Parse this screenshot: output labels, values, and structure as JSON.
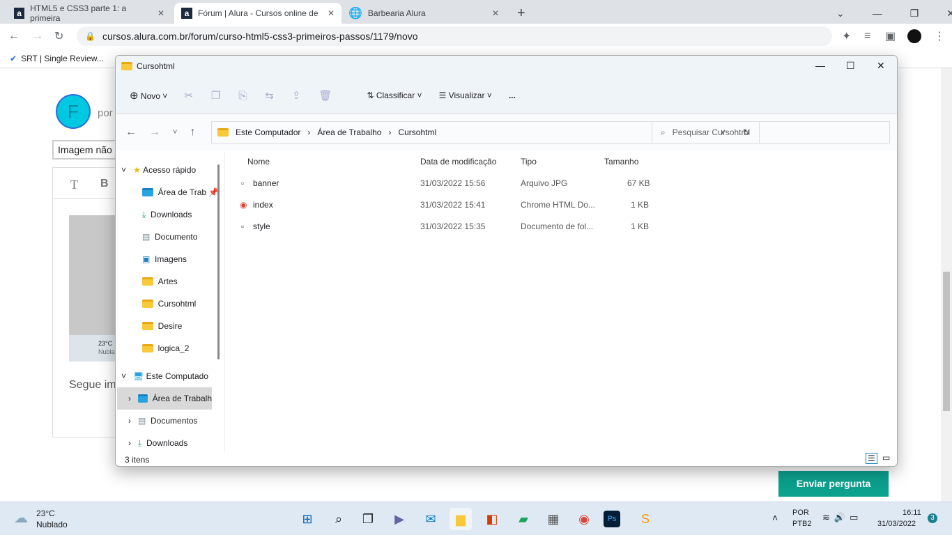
{
  "browser": {
    "tabs": [
      {
        "label": "HTML5 e CSS3 parte 1: a primeira"
      },
      {
        "label": "Fórum | Alura - Cursos online de"
      },
      {
        "label": "Barbearia Alura"
      }
    ],
    "url": "cursos.alura.com.br/forum/curso-html5-css3-primeiros-passos/1179/novo",
    "bookmark": "SRT | Single Review..."
  },
  "page": {
    "avatar_letter": "F",
    "por": "por",
    "title_input": "Imagem não c",
    "editor_t": "T",
    "editor_b": "B",
    "weather_temp": "23°C",
    "weather_desc": "Nubla",
    "body_text": "Segue im",
    "submit": "Enviar pergunta"
  },
  "explorer": {
    "title": "Cursohtml",
    "new_label": "Novo",
    "sort_label": "Classificar",
    "view_label": "Visualizar",
    "more": "...",
    "breadcrumb": [
      "Este Computador",
      "Área de Trabalho",
      "Cursohtml"
    ],
    "search_placeholder": "Pesquisar Cursohtml",
    "sidebar": {
      "quick_access": "Acesso rápido",
      "items": [
        "Área de Trab",
        "Downloads",
        "Documento",
        "Imagens",
        "Artes",
        "Cursohtml",
        "Desire",
        "logica_2"
      ],
      "this_pc": "Este Computado",
      "pc_items": [
        "Área de Trabalh",
        "Documentos",
        "Downloads"
      ]
    },
    "columns": [
      "Nome",
      "Data de modificação",
      "Tipo",
      "Tamanho"
    ],
    "files": [
      {
        "name": "banner",
        "date": "31/03/2022 15:56",
        "type": "Arquivo JPG",
        "size": "67 KB"
      },
      {
        "name": "index",
        "date": "31/03/2022 15:41",
        "type": "Chrome HTML Do...",
        "size": "1 KB"
      },
      {
        "name": "style",
        "date": "31/03/2022 15:35",
        "type": "Documento de fol...",
        "size": "1 KB"
      }
    ],
    "status": "3 itens"
  },
  "taskbar": {
    "temp": "23°C",
    "weather": "Nublado",
    "lang1": "POR",
    "lang2": "PTB2",
    "time": "16:11",
    "date": "31/03/2022",
    "badge": "3"
  }
}
